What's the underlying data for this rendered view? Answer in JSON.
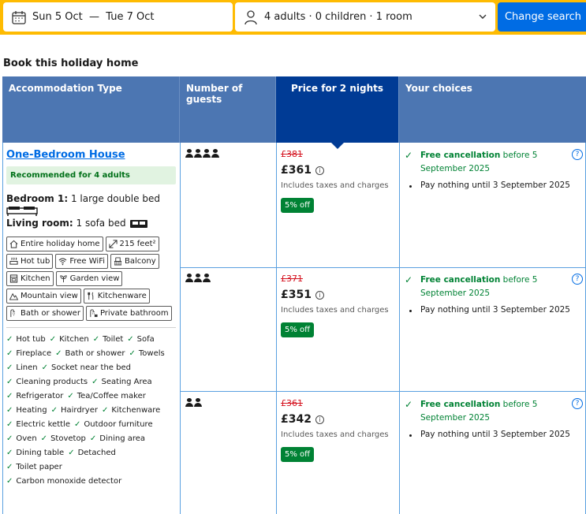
{
  "search": {
    "dates": "Sun 5 Oct  —  Tue 7 Oct",
    "guests": "4 adults · 0 children · 1 room",
    "button": "Change search"
  },
  "section_title": "Book this holiday home",
  "headers": {
    "type": "Accommodation Type",
    "guests": "Number of guests",
    "price": "Price for 2 nights",
    "choices": "Your choices"
  },
  "room": {
    "name": "One-Bedroom House",
    "recommended": "Recommended for 4 adults",
    "bedroom_label": "Bedroom 1:",
    "bedroom_value": " 1 large double bed",
    "living_label": "Living room:",
    "living_value": " 1 sofa bed",
    "chips": [
      "Entire holiday home",
      "215 feet²",
      "Hot tub",
      "Free WiFi",
      "Balcony",
      "Kitchen",
      "Garden view",
      "Mountain view",
      "Kitchenware",
      "Bath or shower",
      "Private bathroom"
    ],
    "facilities": [
      "Hot tub",
      "Kitchen",
      "Toilet",
      "Sofa",
      "Fireplace",
      "Bath or shower",
      "Towels",
      "Linen",
      "Socket near the bed",
      "Cleaning products",
      "Seating Area",
      "Refrigerator",
      "Tea/Coffee maker",
      "Heating",
      "Hairdryer",
      "Kitchenware",
      "Electric kettle",
      "Outdoor furniture",
      "Oven",
      "Stovetop",
      "Dining area",
      "Dining table",
      "Detached",
      "Toilet paper",
      "Carbon monoxide detector"
    ]
  },
  "options": [
    {
      "guests": 4,
      "old_price": "£381",
      "price": "£361",
      "taxes": "Includes taxes and charges",
      "discount": "5% off",
      "fc_bold": "Free cancellation",
      "fc_rest": " before 5 September 2025",
      "pay": "Pay nothing until 3 September 2025"
    },
    {
      "guests": 3,
      "old_price": "£371",
      "price": "£351",
      "taxes": "Includes taxes and charges",
      "discount": "5% off",
      "fc_bold": "Free cancellation",
      "fc_rest": " before 5 September 2025",
      "pay": "Pay nothing until 3 September 2025"
    },
    {
      "guests": 2,
      "old_price": "£361",
      "price": "£342",
      "taxes": "Includes taxes and charges",
      "discount": "5% off",
      "fc_bold": "Free cancellation",
      "fc_rest": " before 5 September 2025",
      "pay": "Pay nothing until 3 September 2025"
    }
  ],
  "colors": {
    "search_border": "#febb02",
    "header": "#4c76b2",
    "header_dark": "#003b95",
    "accent": "#006ce4",
    "green": "#008234",
    "strike": "#d4111e"
  }
}
